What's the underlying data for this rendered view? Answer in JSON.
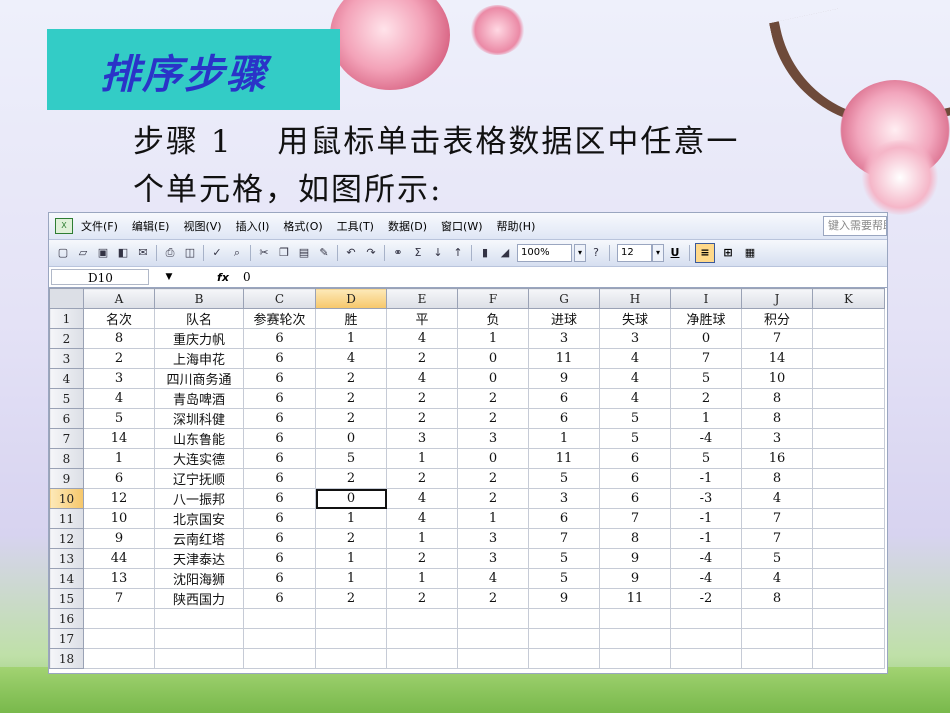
{
  "slide": {
    "title": "排序步骤",
    "step_line1": "步骤 1　 用鼠标单击表格数据区中任意一",
    "step_line2": "个单元格，如图所示:"
  },
  "menu": {
    "items": [
      "文件(F)",
      "编辑(E)",
      "视图(V)",
      "插入(I)",
      "格式(O)",
      "工具(T)",
      "数据(D)",
      "窗口(W)",
      "帮助(H)"
    ],
    "help_placeholder": "键入需要帮助的问题"
  },
  "toolbar": {
    "zoom": "100%",
    "font_size": "12",
    "underline": "U"
  },
  "formula_bar": {
    "name_box": "D10",
    "fx": "fx",
    "value": "0"
  },
  "grid": {
    "columns": [
      "A",
      "B",
      "C",
      "D",
      "E",
      "F",
      "G",
      "H",
      "I",
      "J",
      "K"
    ],
    "selected_column": "D",
    "selected_row": 10,
    "rows": [
      {
        "n": "1",
        "cells": [
          "名次",
          "队名",
          "参赛轮次",
          "胜",
          "平",
          "负",
          "进球",
          "失球",
          "净胜球",
          "积分",
          ""
        ]
      },
      {
        "n": "2",
        "cells": [
          "8",
          "重庆力帆",
          "6",
          "1",
          "4",
          "1",
          "3",
          "3",
          "0",
          "7",
          ""
        ]
      },
      {
        "n": "3",
        "cells": [
          "2",
          "上海申花",
          "6",
          "4",
          "2",
          "0",
          "11",
          "4",
          "7",
          "14",
          ""
        ]
      },
      {
        "n": "4",
        "cells": [
          "3",
          "四川商务通",
          "6",
          "2",
          "4",
          "0",
          "9",
          "4",
          "5",
          "10",
          ""
        ]
      },
      {
        "n": "5",
        "cells": [
          "4",
          "青岛啤酒",
          "6",
          "2",
          "2",
          "2",
          "6",
          "4",
          "2",
          "8",
          ""
        ]
      },
      {
        "n": "6",
        "cells": [
          "5",
          "深圳科健",
          "6",
          "2",
          "2",
          "2",
          "6",
          "5",
          "1",
          "8",
          ""
        ]
      },
      {
        "n": "7",
        "cells": [
          "14",
          "山东鲁能",
          "6",
          "0",
          "3",
          "3",
          "1",
          "5",
          "-4",
          "3",
          ""
        ]
      },
      {
        "n": "8",
        "cells": [
          "1",
          "大连实德",
          "6",
          "5",
          "1",
          "0",
          "11",
          "6",
          "5",
          "16",
          ""
        ]
      },
      {
        "n": "9",
        "cells": [
          "6",
          "辽宁抚顺",
          "6",
          "2",
          "2",
          "2",
          "5",
          "6",
          "-1",
          "8",
          ""
        ]
      },
      {
        "n": "10",
        "cells": [
          "12",
          "八一振邦",
          "6",
          "0",
          "4",
          "2",
          "3",
          "6",
          "-3",
          "4",
          ""
        ]
      },
      {
        "n": "11",
        "cells": [
          "10",
          "北京国安",
          "6",
          "1",
          "4",
          "1",
          "6",
          "7",
          "-1",
          "7",
          ""
        ]
      },
      {
        "n": "12",
        "cells": [
          "9",
          "云南红塔",
          "6",
          "2",
          "1",
          "3",
          "7",
          "8",
          "-1",
          "7",
          ""
        ]
      },
      {
        "n": "13",
        "cells": [
          "44",
          "天津泰达",
          "6",
          "1",
          "2",
          "3",
          "5",
          "9",
          "-4",
          "5",
          ""
        ]
      },
      {
        "n": "14",
        "cells": [
          "13",
          "沈阳海狮",
          "6",
          "1",
          "1",
          "4",
          "5",
          "9",
          "-4",
          "4",
          ""
        ]
      },
      {
        "n": "15",
        "cells": [
          "7",
          "陕西国力",
          "6",
          "2",
          "2",
          "2",
          "9",
          "11",
          "-2",
          "8",
          ""
        ]
      },
      {
        "n": "16",
        "cells": [
          "",
          "",
          "",
          "",
          "",
          "",
          "",
          "",
          "",
          "",
          ""
        ]
      },
      {
        "n": "17",
        "cells": [
          "",
          "",
          "",
          "",
          "",
          "",
          "",
          "",
          "",
          "",
          ""
        ]
      },
      {
        "n": "18",
        "cells": [
          "",
          "",
          "",
          "",
          "",
          "",
          "",
          "",
          "",
          "",
          ""
        ]
      }
    ]
  },
  "colors": {
    "title_bg": "#33ccc6",
    "title_text": "#2a33c8",
    "selection_header": "#f6c76a"
  }
}
